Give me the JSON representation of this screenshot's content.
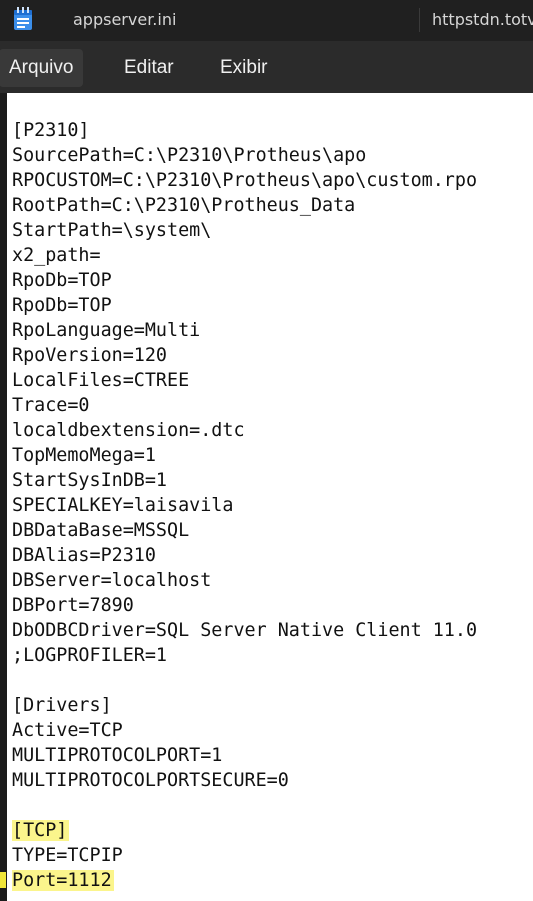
{
  "window": {
    "tabs": [
      {
        "label": "appserver.ini"
      },
      {
        "label": "httpstdn.totv"
      }
    ]
  },
  "menu": {
    "items": [
      "Arquivo",
      "Editar",
      "Exibir"
    ]
  },
  "editor": {
    "lines": [
      "[P2310]",
      "SourcePath=C:\\P2310\\Protheus\\apo",
      "RPOCUSTOM=C:\\P2310\\Protheus\\apo\\custom.rpo",
      "RootPath=C:\\P2310\\Protheus_Data",
      "StartPath=\\system\\",
      "x2_path=",
      "RpoDb=TOP",
      "RpoDb=TOP",
      "RpoLanguage=Multi",
      "RpoVersion=120",
      "LocalFiles=CTREE",
      "Trace=0",
      "localdbextension=.dtc",
      "TopMemoMega=1",
      "StartSysInDB=1",
      "SPECIALKEY=laisavila",
      "DBDataBase=MSSQL",
      "DBAlias=P2310",
      "DBServer=localhost",
      "DBPort=7890",
      "DbODBCDriver=SQL Server Native Client 11.0",
      ";LOGPROFILER=1",
      "",
      "[Drivers]",
      "Active=TCP",
      "MULTIPROTOCOLPORT=1",
      "MULTIPROTOCOLPORTSECURE=0",
      "",
      "[TCP]",
      "TYPE=TCPIP",
      "Port=1112"
    ],
    "highlighted_lines": [
      28,
      30
    ],
    "highlight_color": "#fbf58c"
  }
}
